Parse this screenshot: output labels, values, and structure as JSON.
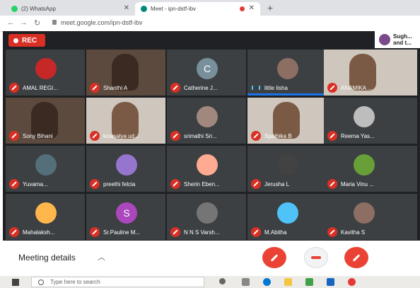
{
  "browser": {
    "tabs": [
      {
        "title": "(2) WhatsApp",
        "favicon_color": "#25d366"
      },
      {
        "title": "Meet - ipn-dstf-ibv",
        "favicon_color": "#00897b"
      }
    ],
    "url": "meet.google.com/ipn-dstf-ibv"
  },
  "meet": {
    "rec_label": "REC",
    "presenter_text": "Sugh... and t...",
    "participants": [
      {
        "name": "AMAL REGI...",
        "type": "avatar",
        "color": "#c62828"
      },
      {
        "name": "Shanthi A",
        "type": "video"
      },
      {
        "name": "Catherine J...",
        "type": "letter",
        "letter": "C",
        "color": "#78909c"
      },
      {
        "name": "little lisha",
        "type": "avatar",
        "color": "#8d6e63",
        "speaking": true
      },
      {
        "name": "ANAMIKA ...",
        "type": "video-light"
      },
      {
        "name": "Sony Bihani",
        "type": "video"
      },
      {
        "name": "kowsalya ud...",
        "type": "video-light"
      },
      {
        "name": "srimathi Sri...",
        "type": "avatar",
        "color": "#a1887f"
      },
      {
        "name": "Spathika B",
        "type": "video-light"
      },
      {
        "name": "Reema Yas...",
        "type": "avatar",
        "color": "#bdbdbd"
      },
      {
        "name": "Yuvama...",
        "type": "avatar",
        "color": "#546e7a"
      },
      {
        "name": "preethi felcia",
        "type": "avatar",
        "color": "#9575cd"
      },
      {
        "name": "Sherin Eben...",
        "type": "avatar",
        "color": "#ffab91"
      },
      {
        "name": "Jerusha L",
        "type": "avatar",
        "color": "#424242"
      },
      {
        "name": "Maria Vinu ...",
        "type": "avatar",
        "color": "#689f38"
      },
      {
        "name": "Mahalaksh...",
        "type": "avatar",
        "color": "#ffb74d"
      },
      {
        "name": "Sr.Pauline M...",
        "type": "letter",
        "letter": "S",
        "color": "#ab47bc"
      },
      {
        "name": "N N S Varsh...",
        "type": "avatar",
        "color": "#757575"
      },
      {
        "name": "M.Abitha",
        "type": "avatar",
        "color": "#4fc3f7"
      },
      {
        "name": "Kavitha S",
        "type": "avatar",
        "color": "#8d6e63"
      }
    ],
    "meeting_details_label": "Meeting details"
  },
  "taskbar": {
    "search_placeholder": "Type here to search"
  },
  "colors": {
    "stage_bg": "#202124",
    "mute_red": "#d93025",
    "end_call_red": "#ea4335"
  }
}
